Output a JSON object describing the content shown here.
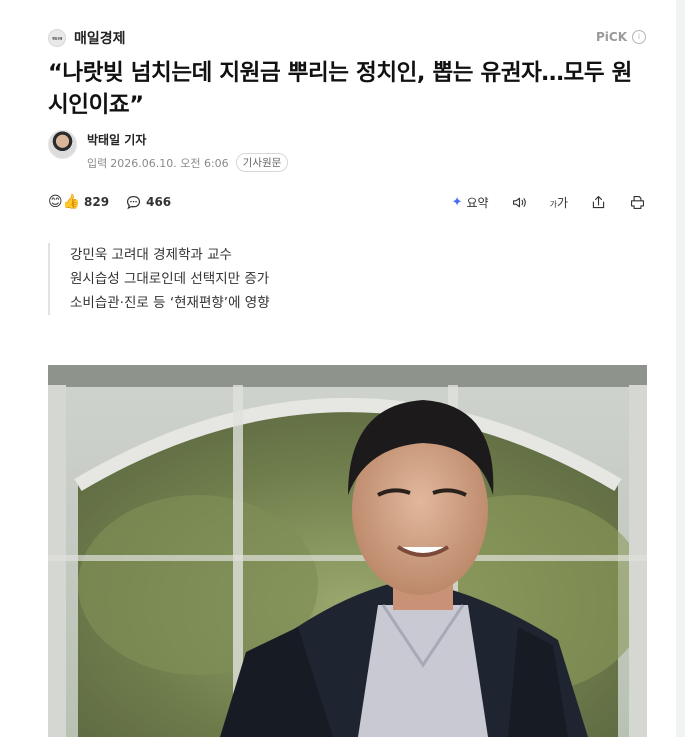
{
  "publisher": {
    "logo_text": "매일경제",
    "name": "매일경제"
  },
  "pick": {
    "label": "PiCK",
    "info_icon": "info-icon"
  },
  "article": {
    "title": "“나랏빚 넘치는데 지원금 뿌리는 정치인, 뽑는 유권자…모두 원시인이죠”",
    "author": "박태일 기자",
    "date_label": "입력",
    "date": "2026.06.10. 오전 6:06",
    "original_button": "기사원문",
    "summary": [
      "강민욱 고려대 경제학과 교수",
      "원시습성 그대로인데 선택지만 증가",
      "소비습관·진로 등 ‘현재편향’에 영향"
    ]
  },
  "toolbar": {
    "reaction_count": "829",
    "comment_count": "466",
    "summary_label": "요약",
    "font_label": "가",
    "font_small": "가",
    "icons": [
      "reaction-emoji-icon",
      "comment-icon",
      "ai-summary-icon",
      "audio-icon",
      "font-size-icon",
      "share-icon",
      "print-icon"
    ]
  },
  "colors": {
    "accent": "#4a6cf7",
    "text": "#111111",
    "meta": "#8a8a8a"
  }
}
